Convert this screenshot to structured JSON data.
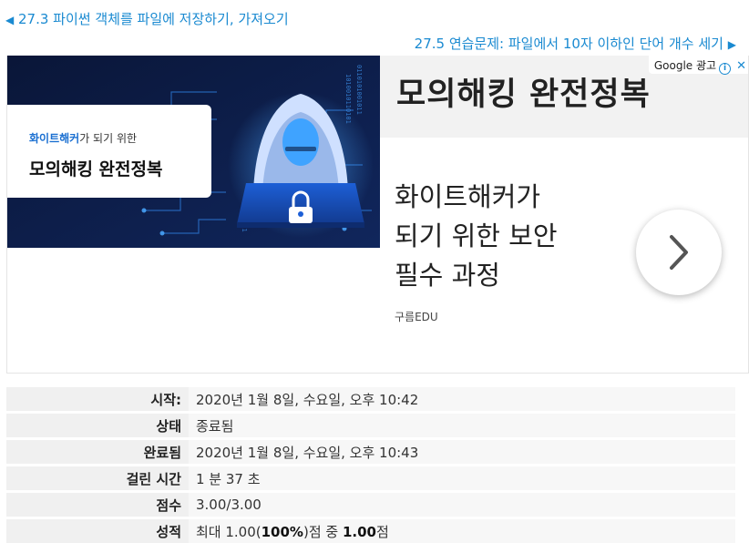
{
  "nav": {
    "prev_arrow": "◀",
    "prev_label": "27.3 파이썬 객체를 파일에 저장하기, 가져오기",
    "next_label": "27.5 연습문제: 파일에서 10자 이하인 단어 개수 세기",
    "next_arrow": "▶",
    "color": "#1a8ad1"
  },
  "ad": {
    "badge_label": "Google 광고",
    "badge_info_icon": "i",
    "badge_close_icon": "✕",
    "image_sub_highlight": "화이트해커",
    "image_sub_rest": "가 되기 위한",
    "image_title": "모의해킹 완전정복",
    "headline": "모의해킹 완전정복",
    "description_lines": [
      "화이트해커가",
      "되기 위한 보안",
      "필수 과정"
    ],
    "brand": "구름EDU",
    "cta_icon": "chevron-right-icon"
  },
  "info": {
    "rows": [
      {
        "label": "시작:",
        "value": "2020년 1월 8일, 수요일, 오후 10:42"
      },
      {
        "label": "상태",
        "value": "종료됨"
      },
      {
        "label": "완료됨",
        "value": "2020년 1월 8일, 수요일, 오후 10:43"
      },
      {
        "label": "걸린 시간",
        "value": "1 분 37 초"
      },
      {
        "label": "점수",
        "value": "3.00/3.00"
      },
      {
        "label": "성적",
        "value_parts": [
          "최대 1.00(",
          "100%",
          ")점 중 ",
          "1.00",
          "점"
        ]
      }
    ]
  }
}
